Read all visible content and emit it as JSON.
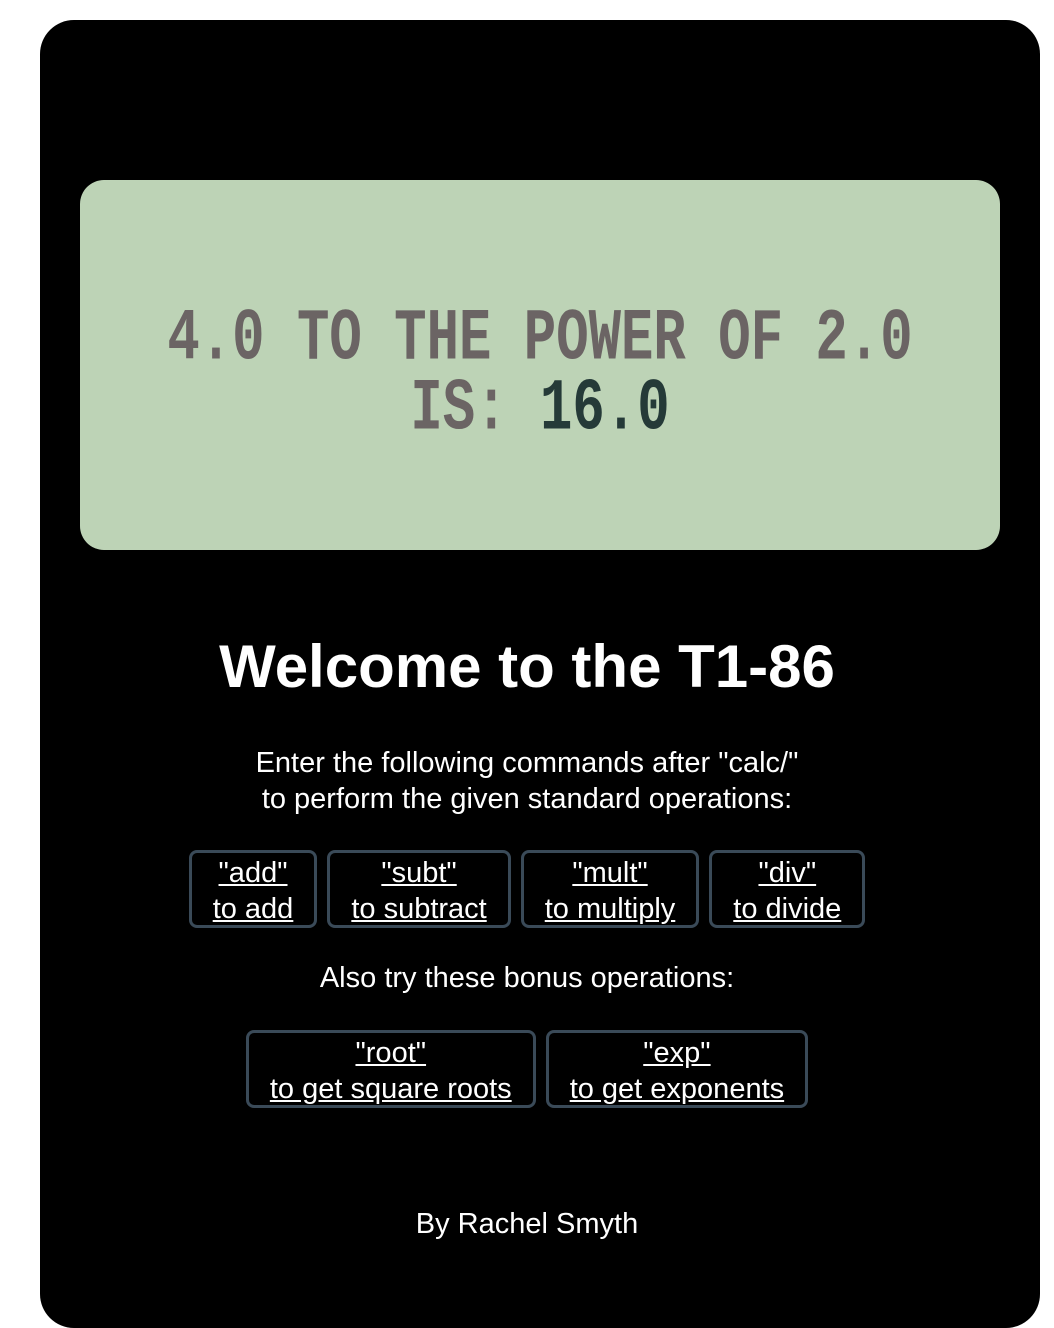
{
  "display": {
    "expression": "4.0 TO THE POWER OF 2.0",
    "prefix": "IS:",
    "result": "16.0"
  },
  "title": "Welcome to the T1-86",
  "intro": [
    "Enter the following commands after \"calc/\"",
    "to perform the given standard operations:"
  ],
  "commands": [
    {
      "cmd": "\"add\"",
      "desc": "to add"
    },
    {
      "cmd": "\"subt\"",
      "desc": "to subtract"
    },
    {
      "cmd": "\"mult\"",
      "desc": "to multiply"
    },
    {
      "cmd": "\"div\"",
      "desc": "to divide"
    }
  ],
  "bonus_label": "Also try these bonus operations:",
  "bonus": [
    {
      "cmd": "\"root\"",
      "desc": "to get square roots"
    },
    {
      "cmd": "\"exp\"",
      "desc": "to get exponents"
    }
  ],
  "footer": "By Rachel Smyth"
}
